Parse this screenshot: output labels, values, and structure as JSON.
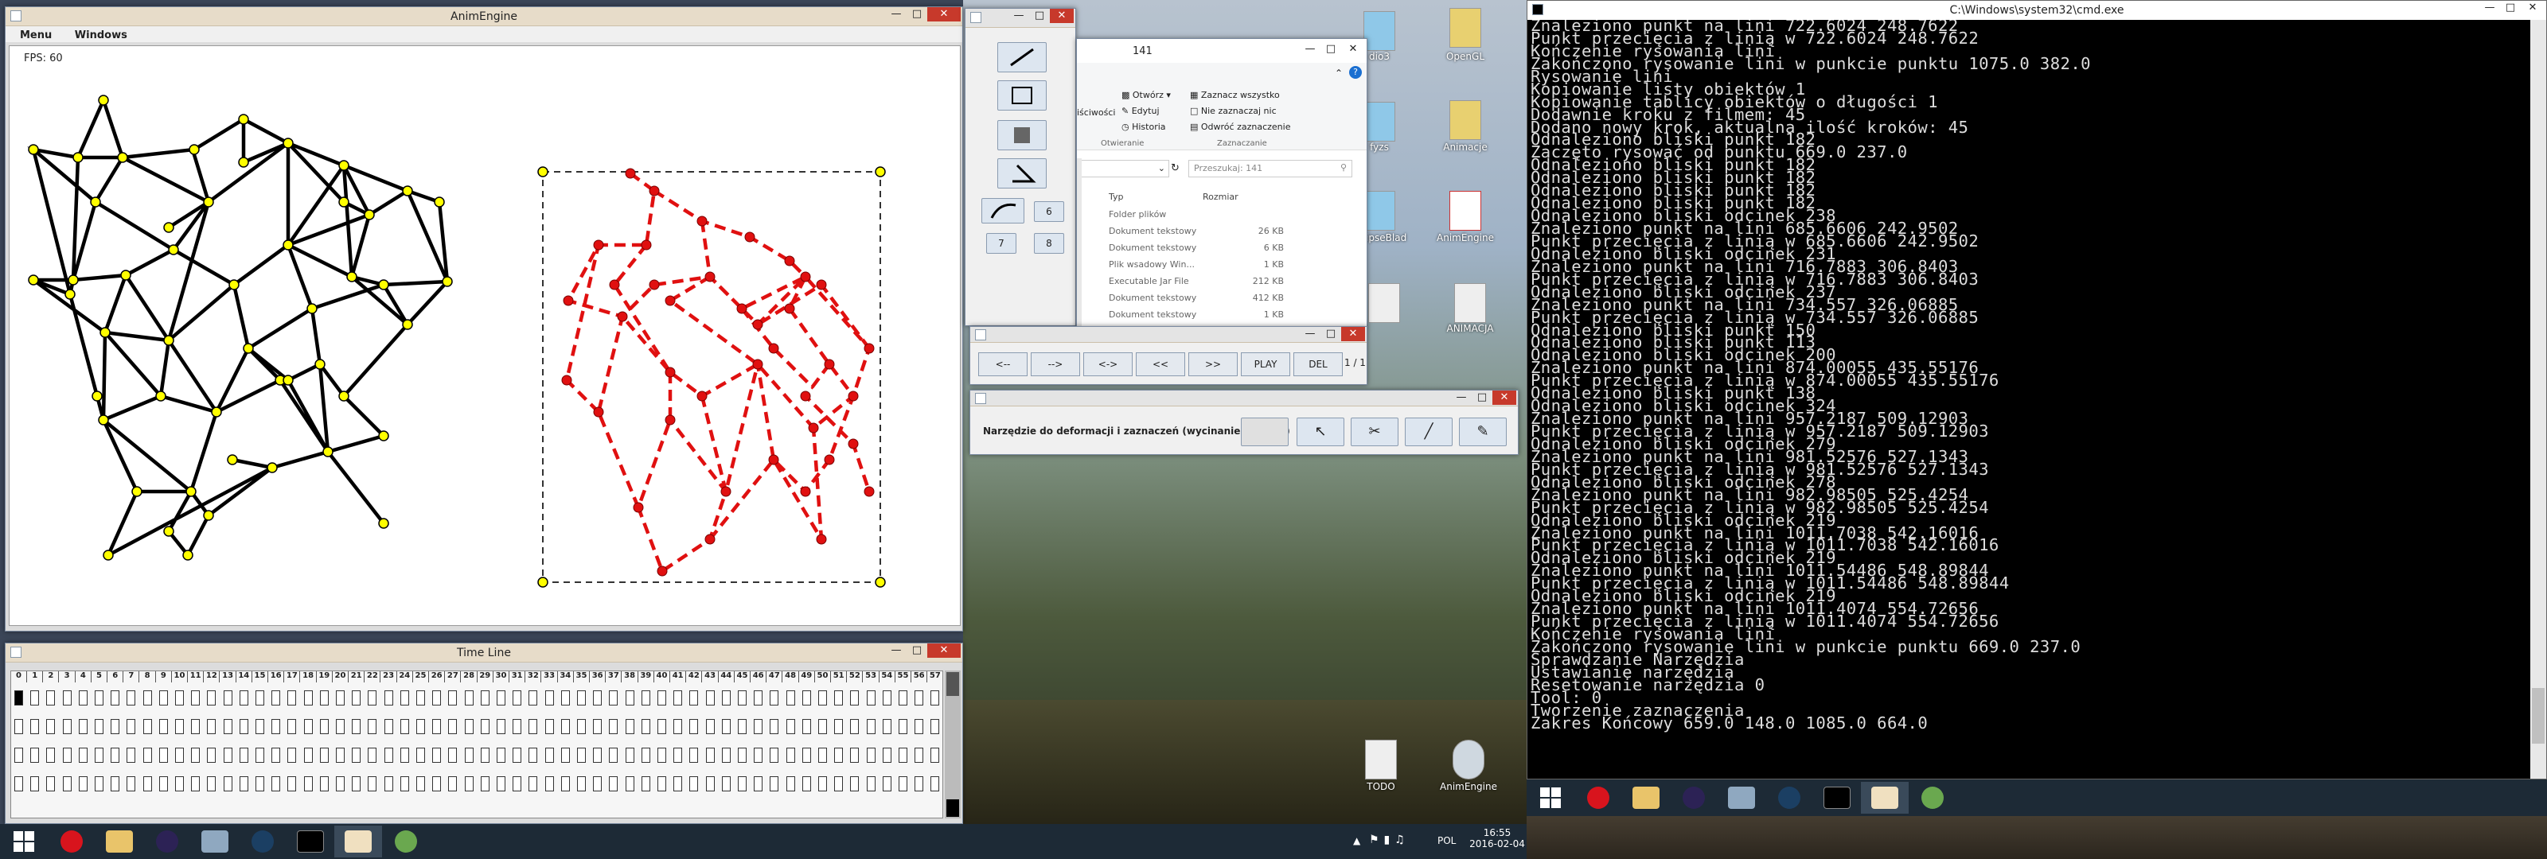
{
  "anim": {
    "title": "AnimEngine",
    "menu": [
      "Menu",
      "Windows"
    ],
    "fps": "FPS: 60"
  },
  "timeline": {
    "title": "Time Line",
    "frames": [
      "0",
      "1",
      "2",
      "3",
      "4",
      "5",
      "6",
      "7",
      "8",
      "9",
      "10",
      "11",
      "12",
      "13",
      "14",
      "15",
      "16",
      "17",
      "18",
      "19",
      "20",
      "21",
      "22",
      "23",
      "24",
      "25",
      "26",
      "27",
      "28",
      "29",
      "30",
      "31",
      "32",
      "33",
      "34",
      "35",
      "36",
      "37",
      "38",
      "39",
      "40",
      "41",
      "42",
      "43",
      "44",
      "45",
      "46",
      "47",
      "48",
      "49",
      "50",
      "51",
      "52",
      "53",
      "54",
      "55",
      "56",
      "57"
    ]
  },
  "tools": {
    "labels": [
      "6",
      "7",
      "8"
    ]
  },
  "explorer": {
    "title": "141",
    "menu": [
      "Otwórz",
      "Edytuj",
      "Historia"
    ],
    "select": [
      "Zaznacz wszystko",
      "Nie zaznaczaj nic",
      "Odwróć zaznaczenie"
    ],
    "groups": [
      "Otwieranie",
      "Zaznaczanie"
    ],
    "side": "iściwości",
    "search": "Przeszukaj: 141",
    "cols": [
      "Typ",
      "Rozmiar"
    ],
    "rows": [
      [
        "Folder plików",
        ""
      ],
      [
        "Dokument tekstowy",
        "26 KB"
      ],
      [
        "Dokument tekstowy",
        "6 KB"
      ],
      [
        "Plik wsadowy Win...",
        "1 KB"
      ],
      [
        "Executable Jar File",
        "212 KB"
      ],
      [
        "Dokument tekstowy",
        "412 KB"
      ],
      [
        "Dokument tekstowy",
        "1 KB"
      ]
    ]
  },
  "player": {
    "buttons": [
      "<--",
      "-->",
      "<->",
      "<<",
      ">>",
      "PLAY",
      "DEL"
    ],
    "page": "1 / 1"
  },
  "deform": {
    "label": "Narzędzie do deformacji i zaznaczeń (wycinanie odcinka)"
  },
  "desktop": {
    "icons": [
      "dio3",
      "OpenGL",
      "fyzs",
      "Animacje",
      "eclipseBlad",
      "AnimEngine",
      "ANIMACJA",
      "TODO",
      "AnimEngine"
    ]
  },
  "cmd": {
    "title": "C:\\Windows\\system32\\cmd.exe",
    "lines": [
      "Znaleziono punkt na lini 722.6024 248.7622",
      "Punkt przecięcia z linią w 722.6024 248.7622",
      "Kończenie rysowania lini",
      "Zakończono rysowanie lini w punkcie punktu 1075.0 382.0",
      "Rysowanie lini",
      "Kopiowanie listy obiektów 1",
      "Kopiowanie tablicy obiektów o długości 1",
      "Dodawnie kroku z filmem: 45",
      "Dodano nowy krok, aktualna ilość kroków: 45",
      "Odnaleziono bliski punkt 182",
      "Zaczęto rysować od punktu 669.0 237.0",
      "Odnaleziono bliski punkt 182",
      "Odnaleziono bliski punkt 182",
      "Odnaleziono bliski punkt 182",
      "Odnaleziono bliski punkt 182",
      "Odnaleziono bliski odcinek 238",
      "Znaleziono punkt na lini 685.6606 242.9502",
      "Punkt przecięcia z linią w 685.6606 242.9502",
      "Odnaleziono bliski odcinek 231",
      "Znaleziono punkt na lini 716.7883 306.8403",
      "Punkt przecięcia z linią w 716.7883 306.8403",
      "Odnaleziono bliski odcinek 237",
      "Znaleziono punkt na lini 734.557 326.06885",
      "Punkt przecięcia z linią w 734.557 326.06885",
      "Odnaleziono bliski punkt 150",
      "Odnaleziono bliski punkt 113",
      "Odnaleziono bliski odcinek 200",
      "Znaleziono punkt na lini 874.00055 435.55176",
      "Punkt przecięcia z linią w 874.00055 435.55176",
      "Odnaleziono bliski punkt 138",
      "Odnaleziono bliski odcinek 324",
      "Znaleziono punkt na lini 957.2187 509.12903",
      "Punkt przecięcia z linią w 957.2187 509.12903",
      "Odnaleziono bliski odcinek 279",
      "Znaleziono punkt na lini 981.52576 527.1343",
      "Punkt przecięcia z linią w 981.52576 527.1343",
      "Odnaleziono bliski odcinek 278",
      "Znaleziono punkt na lini 982.98505 525.4254",
      "Punkt przecięcia z linią w 982.98505 525.4254",
      "Odnaleziono bliski odcinek 219",
      "Znaleziono punkt na lini 1011.7038 542.16016",
      "Punkt przecięcia z linią w 1011.7038 542.16016",
      "Odnaleziono bliski odcinek 219",
      "Znaleziono punkt na lini 1011.54486 548.89844",
      "Punkt przecięcia z linią w 1011.54486 548.89844",
      "Odnaleziono bliski odcinek 219",
      "Znaleziono punkt na lini 1011.4074 554.72656",
      "Punkt przecięcia z linią w 1011.4074 554.72656",
      "Kończenie rysowania lini",
      "Zakończono rysowanie lini w punkcie punktu 669.0 237.0",
      "Sprawdzanie Narzędzia",
      "Ustawianie narzędzia",
      "Resetowanie narzędzia 0",
      "Tool: 0",
      "Tworzenie zaznaczenia",
      "Zakres Końcowy 659.0 148.0 1085.0 664.0"
    ]
  },
  "taskbar": {
    "lang": "POL",
    "time": "16:55",
    "date": "2016-02-04"
  }
}
